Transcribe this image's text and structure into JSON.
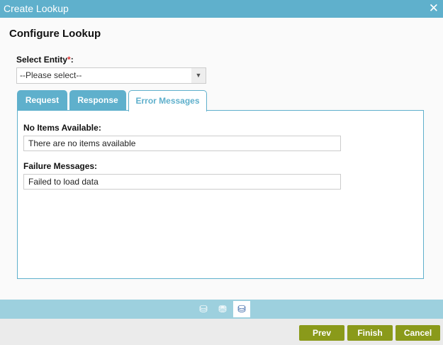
{
  "window": {
    "title": "Create Lookup"
  },
  "heading": "Configure Lookup",
  "entity": {
    "label": "Select Entity",
    "required": "*",
    "colon": ":",
    "value": "--Please select--"
  },
  "tabs": [
    {
      "label": "Request"
    },
    {
      "label": "Response"
    },
    {
      "label": "Error Messages"
    }
  ],
  "fields": {
    "no_items_label": "No Items Available:",
    "no_items_value": "There are no items available",
    "failure_label": "Failure Messages:",
    "failure_value": "Failed to load data"
  },
  "buttons": {
    "prev": "Prev",
    "finish": "Finish",
    "cancel": "Cancel"
  }
}
